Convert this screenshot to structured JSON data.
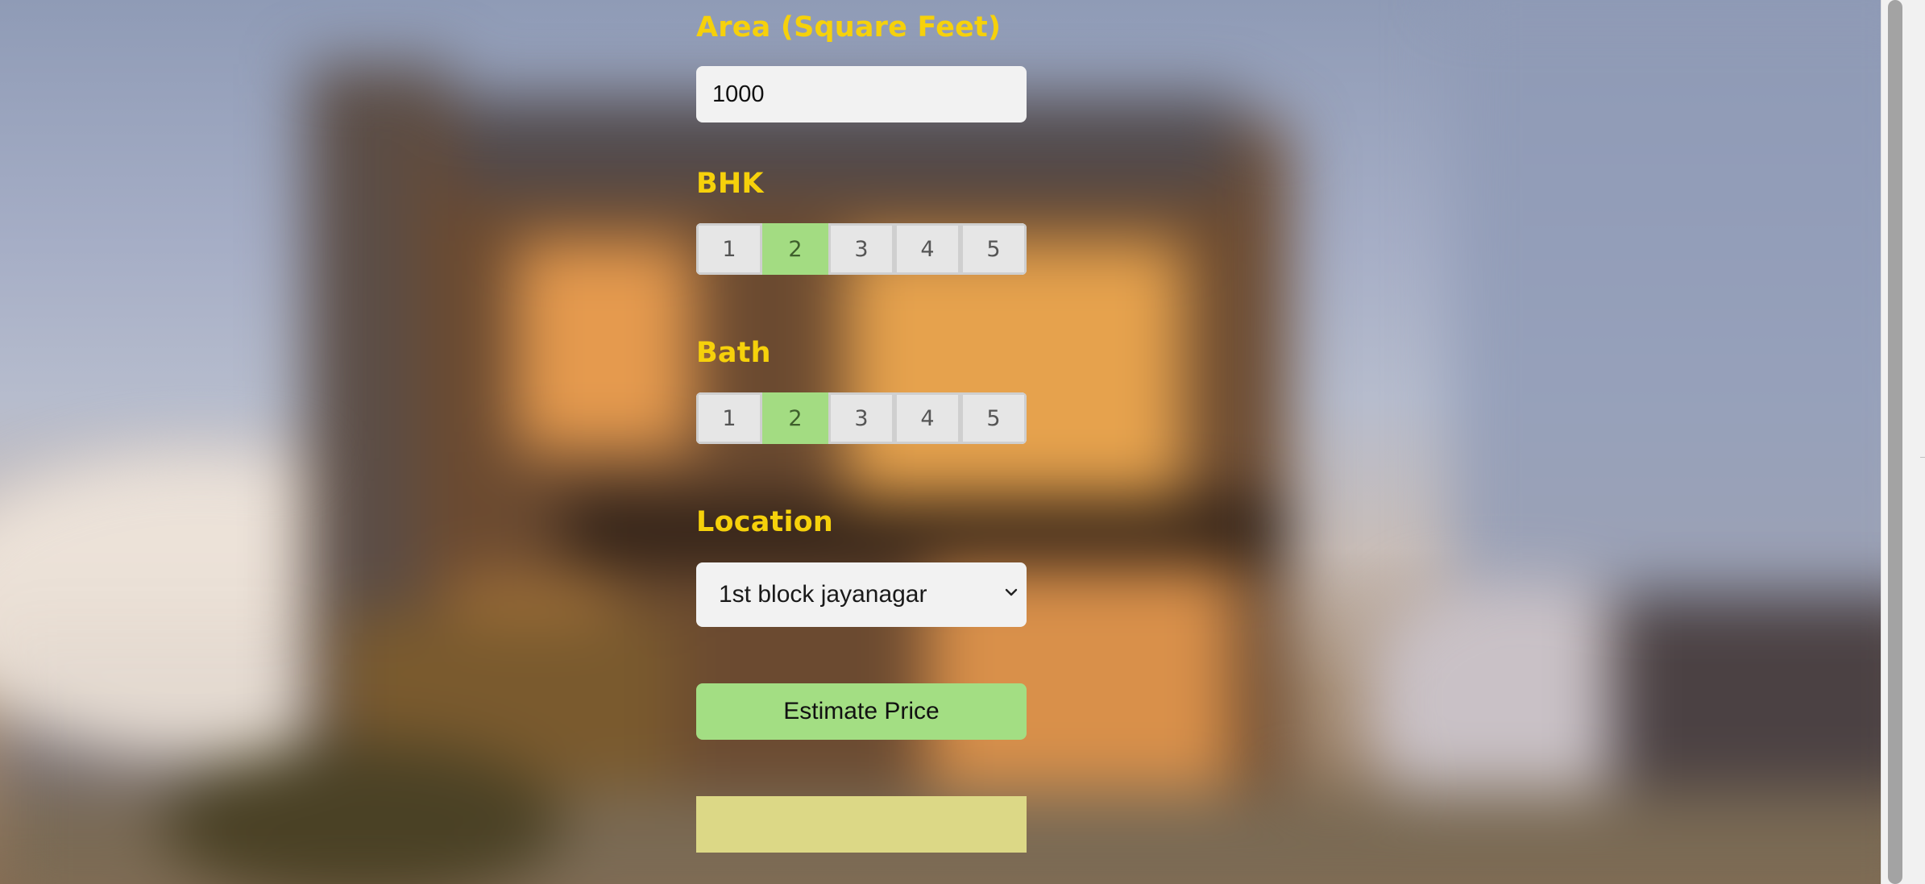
{
  "form": {
    "area": {
      "label": "Area (Square Feet)",
      "value": "1000"
    },
    "bhk": {
      "label": "BHK",
      "options": [
        "1",
        "2",
        "3",
        "4",
        "5"
      ],
      "selected": "2"
    },
    "bath": {
      "label": "Bath",
      "options": [
        "1",
        "2",
        "3",
        "4",
        "5"
      ],
      "selected": "2"
    },
    "location": {
      "label": "Location",
      "selected": "1st block jayanagar"
    },
    "estimate_button": "Estimate Price",
    "result_text": ""
  },
  "colors": {
    "label_yellow": "#f6d10b",
    "selected_green": "#a3dc82",
    "result_box": "#dcd886"
  },
  "icons": {
    "select_arrow": "chevron-down-icon"
  }
}
